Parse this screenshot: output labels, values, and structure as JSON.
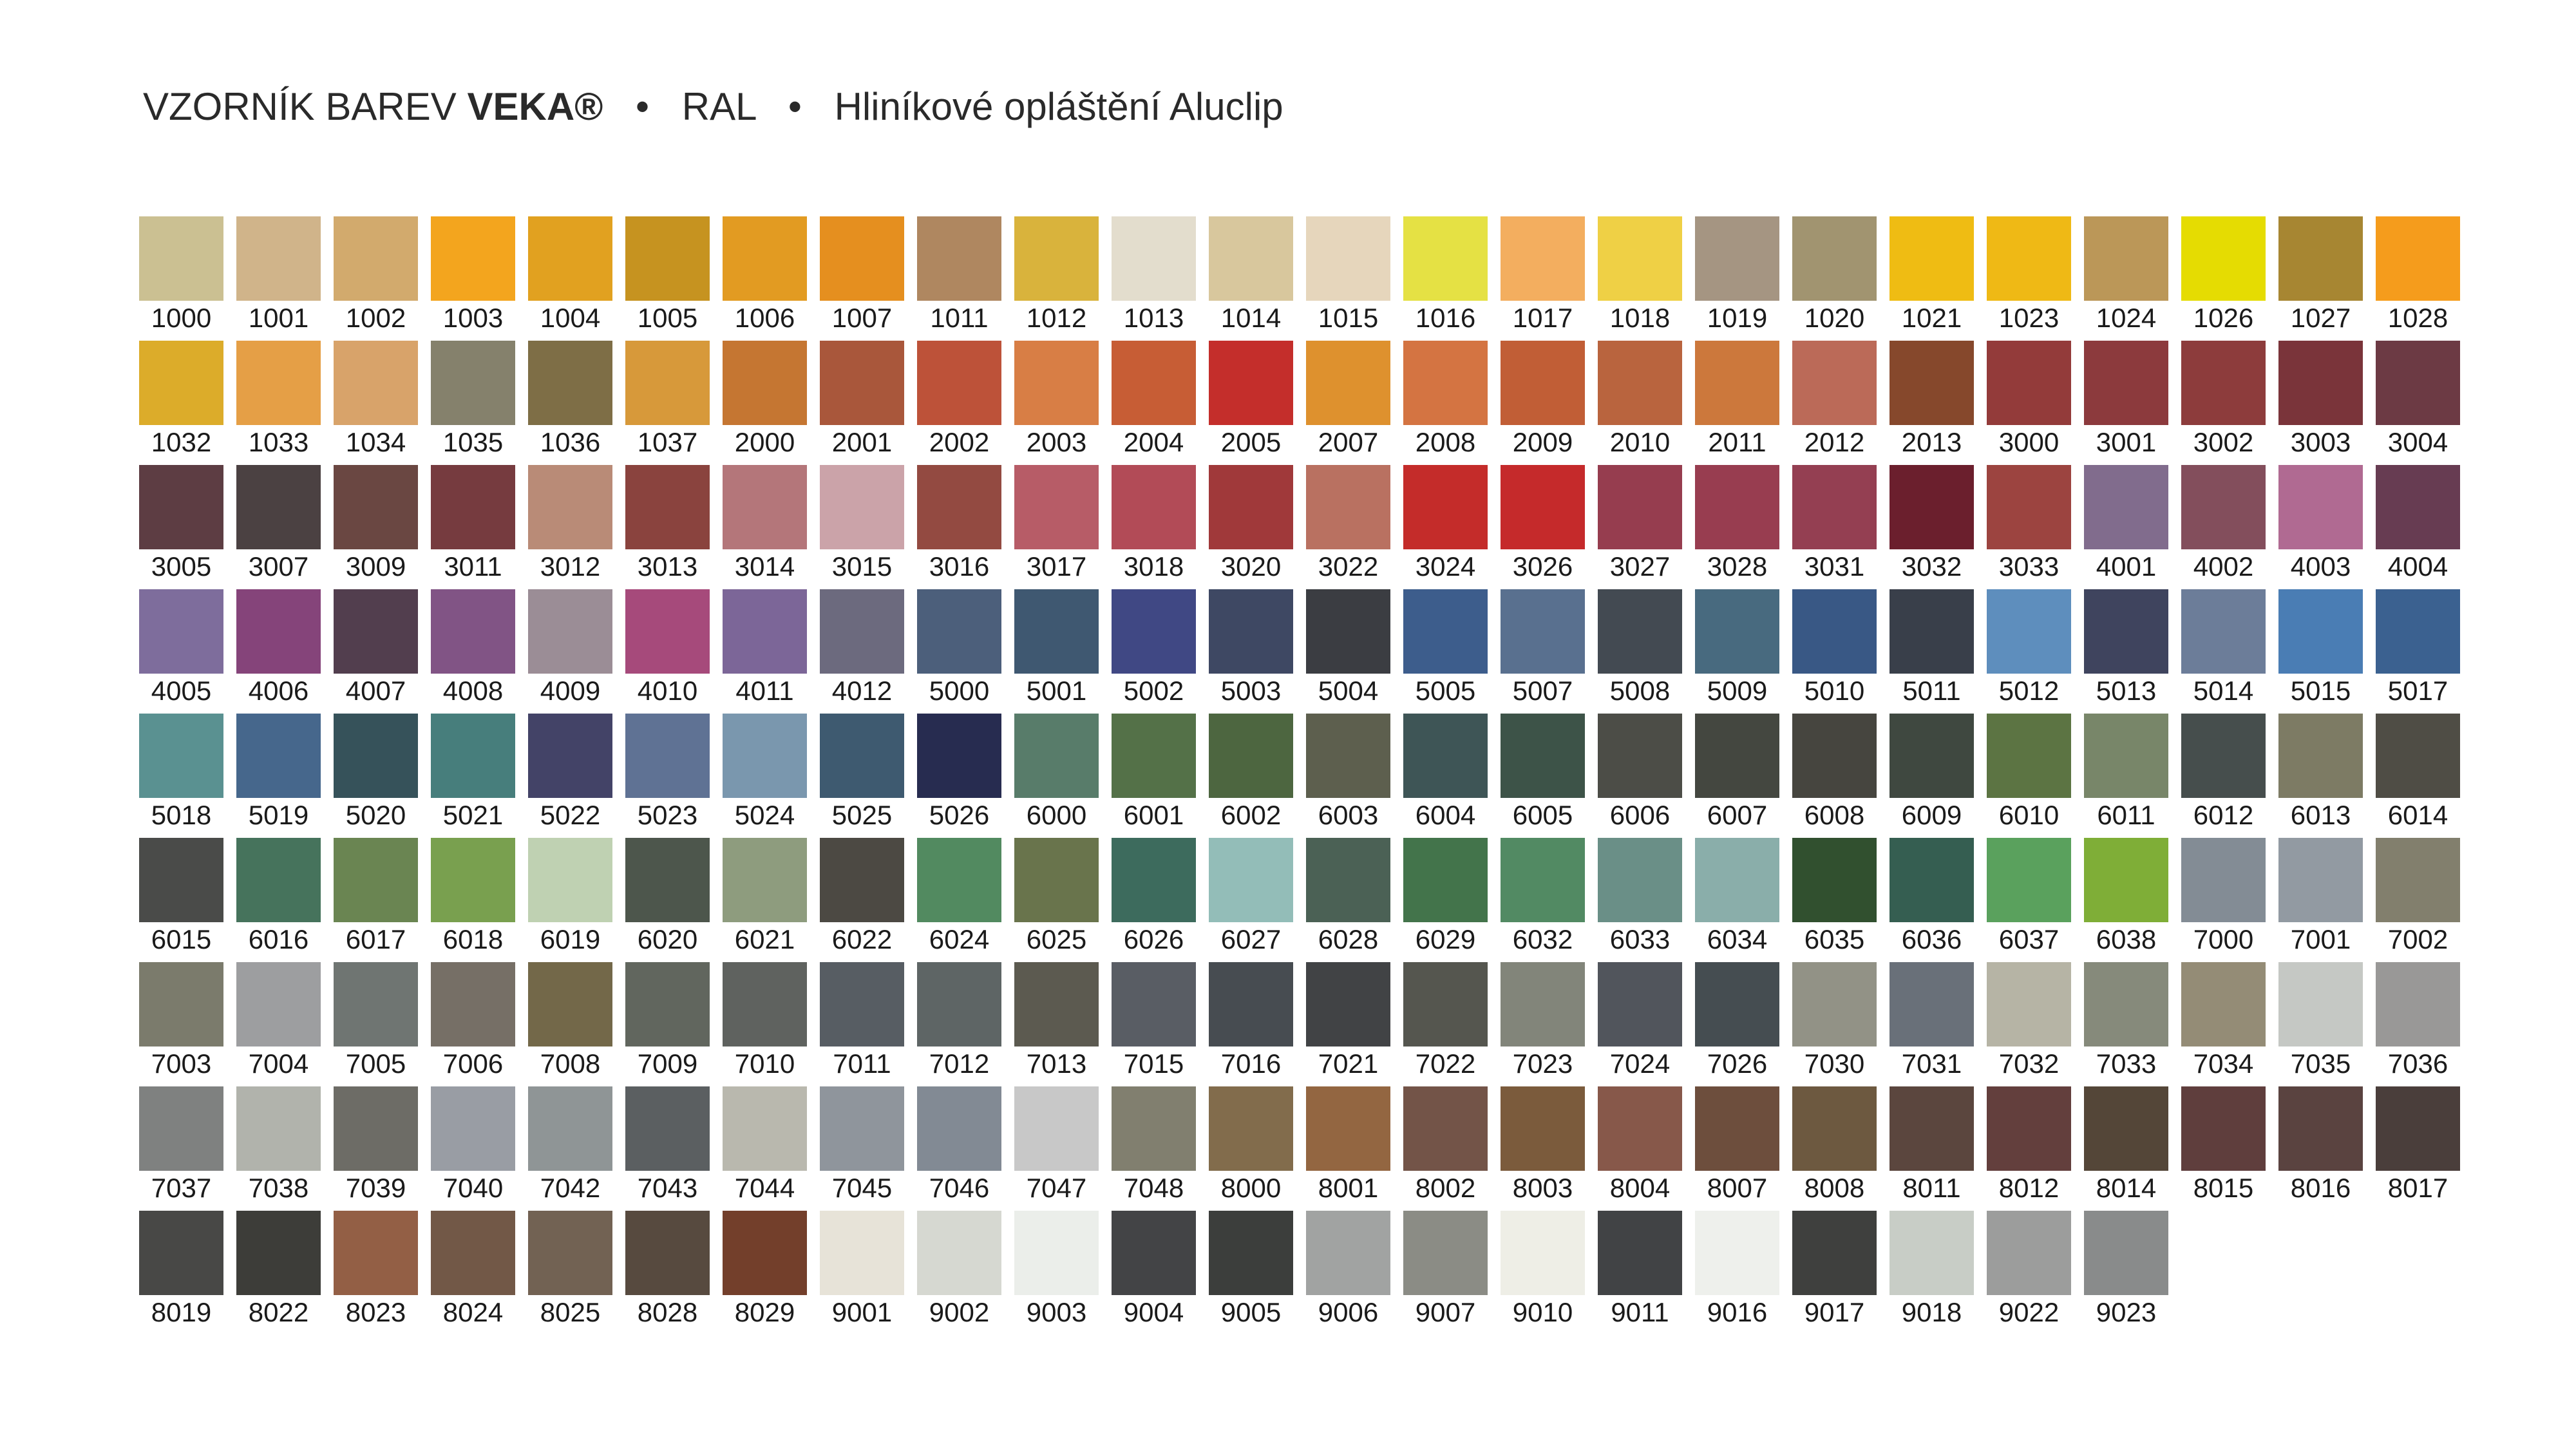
{
  "header": {
    "prefix": "VZORNÍK BAREV",
    "brand": "VEKA®",
    "separator": "•",
    "system": "RAL",
    "product": "Hliníkové opláštění Aluclip"
  },
  "colors": [
    {
      "code": "1000",
      "hex": "#cbc092"
    },
    {
      "code": "1001",
      "hex": "#d0b48a"
    },
    {
      "code": "1002",
      "hex": "#d2aa6d"
    },
    {
      "code": "1003",
      "hex": "#f3a51e"
    },
    {
      "code": "1004",
      "hex": "#e1a120"
    },
    {
      "code": "1005",
      "hex": "#c69320"
    },
    {
      "code": "1006",
      "hex": "#e29b22"
    },
    {
      "code": "1007",
      "hex": "#e58f1f"
    },
    {
      "code": "1011",
      "hex": "#af8760"
    },
    {
      "code": "1012",
      "hex": "#d9b33c"
    },
    {
      "code": "1013",
      "hex": "#e3ddcd"
    },
    {
      "code": "1014",
      "hex": "#d8c79d"
    },
    {
      "code": "1015",
      "hex": "#e6d6bc"
    },
    {
      "code": "1016",
      "hex": "#e5e144"
    },
    {
      "code": "1017",
      "hex": "#f3ae5f"
    },
    {
      "code": "1018",
      "hex": "#efd045"
    },
    {
      "code": "1019",
      "hex": "#a59582"
    },
    {
      "code": "1020",
      "hex": "#a19470"
    },
    {
      "code": "1021",
      "hex": "#efbc13"
    },
    {
      "code": "1023",
      "hex": "#efb915"
    },
    {
      "code": "1024",
      "hex": "#bb9758"
    },
    {
      "code": "1026",
      "hex": "#e5dc02"
    },
    {
      "code": "1027",
      "hex": "#a78632"
    },
    {
      "code": "1028",
      "hex": "#f59c1c"
    },
    {
      "code": "1032",
      "hex": "#dcac2a"
    },
    {
      "code": "1033",
      "hex": "#e59f46"
    },
    {
      "code": "1034",
      "hex": "#d8a36a"
    },
    {
      "code": "1035",
      "hex": "#85816c"
    },
    {
      "code": "1036",
      "hex": "#7e6e46"
    },
    {
      "code": "1037",
      "hex": "#d7993a"
    },
    {
      "code": "2000",
      "hex": "#c57632"
    },
    {
      "code": "2001",
      "hex": "#a9573b"
    },
    {
      "code": "2002",
      "hex": "#bd5239"
    },
    {
      "code": "2003",
      "hex": "#d87e45"
    },
    {
      "code": "2004",
      "hex": "#c75d35"
    },
    {
      "code": "2005",
      "hex": "#c42e2b"
    },
    {
      "code": "2007",
      "hex": "#de912e"
    },
    {
      "code": "2008",
      "hex": "#d47442"
    },
    {
      "code": "2009",
      "hex": "#c15e36"
    },
    {
      "code": "2010",
      "hex": "#b9643e"
    },
    {
      "code": "2011",
      "hex": "#cc783c"
    },
    {
      "code": "2012",
      "hex": "#bb6a58"
    },
    {
      "code": "2013",
      "hex": "#86482c"
    },
    {
      "code": "3000",
      "hex": "#933b3a"
    },
    {
      "code": "3001",
      "hex": "#8c3a3d"
    },
    {
      "code": "3002",
      "hex": "#8d3c3c"
    },
    {
      "code": "3003",
      "hex": "#7a343a"
    },
    {
      "code": "3004",
      "hex": "#6c3a44"
    },
    {
      "code": "3005",
      "hex": "#5d3d43"
    },
    {
      "code": "3007",
      "hex": "#4b4142"
    },
    {
      "code": "3009",
      "hex": "#6a4742"
    },
    {
      "code": "3011",
      "hex": "#763b3f"
    },
    {
      "code": "3012",
      "hex": "#b98b77"
    },
    {
      "code": "3013",
      "hex": "#8a433e"
    },
    {
      "code": "3014",
      "hex": "#b4767a"
    },
    {
      "code": "3015",
      "hex": "#cba3a9"
    },
    {
      "code": "3016",
      "hex": "#934a41"
    },
    {
      "code": "3017",
      "hex": "#b75c67"
    },
    {
      "code": "3018",
      "hex": "#b24b57"
    },
    {
      "code": "3020",
      "hex": "#a0393a"
    },
    {
      "code": "3022",
      "hex": "#b97161"
    },
    {
      "code": "3024",
      "hex": "#c42c2a"
    },
    {
      "code": "3026",
      "hex": "#c52a2b"
    },
    {
      "code": "3027",
      "hex": "#963d4f"
    },
    {
      "code": "3028",
      "hex": "#983d50"
    },
    {
      "code": "3031",
      "hex": "#943f52"
    },
    {
      "code": "3032",
      "hex": "#6b1f2d"
    },
    {
      "code": "3033",
      "hex": "#9c4440"
    },
    {
      "code": "4001",
      "hex": "#816c8d"
    },
    {
      "code": "4002",
      "hex": "#834e5c"
    },
    {
      "code": "4003",
      "hex": "#b06a92"
    },
    {
      "code": "4004",
      "hex": "#673c52"
    },
    {
      "code": "4005",
      "hex": "#7e6d9c"
    },
    {
      "code": "4006",
      "hex": "#85447a"
    },
    {
      "code": "4007",
      "hex": "#523e4e"
    },
    {
      "code": "4008",
      "hex": "#815485"
    },
    {
      "code": "4009",
      "hex": "#9b8d96"
    },
    {
      "code": "4010",
      "hex": "#a64a7b"
    },
    {
      "code": "4011",
      "hex": "#7c6698"
    },
    {
      "code": "4012",
      "hex": "#6c6a7e"
    },
    {
      "code": "5000",
      "hex": "#4c5f7b"
    },
    {
      "code": "5001",
      "hex": "#3f5871"
    },
    {
      "code": "5002",
      "hex": "#404884"
    },
    {
      "code": "5003",
      "hex": "#3e4863"
    },
    {
      "code": "5004",
      "hex": "#3b3d42"
    },
    {
      "code": "5005",
      "hex": "#3d5d8c"
    },
    {
      "code": "5007",
      "hex": "#59708f"
    },
    {
      "code": "5008",
      "hex": "#434a52"
    },
    {
      "code": "5009",
      "hex": "#486a7f"
    },
    {
      "code": "5010",
      "hex": "#395885"
    },
    {
      "code": "5011",
      "hex": "#393f4a"
    },
    {
      "code": "5012",
      "hex": "#5e8ebd"
    },
    {
      "code": "5013",
      "hex": "#3f445e"
    },
    {
      "code": "5014",
      "hex": "#6c7d99"
    },
    {
      "code": "5015",
      "hex": "#4a7db4"
    },
    {
      "code": "5017",
      "hex": "#3b6190"
    },
    {
      "code": "5018",
      "hex": "#5a9191"
    },
    {
      "code": "5019",
      "hex": "#46678c"
    },
    {
      "code": "5020",
      "hex": "#36525a"
    },
    {
      "code": "5021",
      "hex": "#477e7c"
    },
    {
      "code": "5022",
      "hex": "#434367"
    },
    {
      "code": "5023",
      "hex": "#5f7294"
    },
    {
      "code": "5024",
      "hex": "#7a97ae"
    },
    {
      "code": "5025",
      "hex": "#3e5a70"
    },
    {
      "code": "5026",
      "hex": "#272c50"
    },
    {
      "code": "6000",
      "hex": "#587c6a"
    },
    {
      "code": "6001",
      "hex": "#547148"
    },
    {
      "code": "6002",
      "hex": "#4d6640"
    },
    {
      "code": "6003",
      "hex": "#5d5f4e"
    },
    {
      "code": "6004",
      "hex": "#3e5556"
    },
    {
      "code": "6005",
      "hex": "#3d5348"
    },
    {
      "code": "6006",
      "hex": "#4c4d47"
    },
    {
      "code": "6007",
      "hex": "#444740"
    },
    {
      "code": "6008",
      "hex": "#46453f"
    },
    {
      "code": "6009",
      "hex": "#3f4840"
    },
    {
      "code": "6010",
      "hex": "#5c7443"
    },
    {
      "code": "6011",
      "hex": "#788669"
    },
    {
      "code": "6012",
      "hex": "#464e4d"
    },
    {
      "code": "6013",
      "hex": "#7d7b64"
    },
    {
      "code": "6014",
      "hex": "#4f4d45"
    },
    {
      "code": "6015",
      "hex": "#4a4b49"
    },
    {
      "code": "6016",
      "hex": "#46735c"
    },
    {
      "code": "6017",
      "hex": "#6a8552"
    },
    {
      "code": "6018",
      "hex": "#79a04f"
    },
    {
      "code": "6019",
      "hex": "#bfd1b2"
    },
    {
      "code": "6020",
      "hex": "#4d564c"
    },
    {
      "code": "6021",
      "hex": "#8e9c7e"
    },
    {
      "code": "6022",
      "hex": "#4c4943"
    },
    {
      "code": "6024",
      "hex": "#528a60"
    },
    {
      "code": "6025",
      "hex": "#69744c"
    },
    {
      "code": "6026",
      "hex": "#3d6b5d"
    },
    {
      "code": "6027",
      "hex": "#93bdb8"
    },
    {
      "code": "6028",
      "hex": "#4b6155"
    },
    {
      "code": "6029",
      "hex": "#43744b"
    },
    {
      "code": "6032",
      "hex": "#528a63"
    },
    {
      "code": "6033",
      "hex": "#6a8f87"
    },
    {
      "code": "6034",
      "hex": "#8aaeaa"
    },
    {
      "code": "6035",
      "hex": "#31502f"
    },
    {
      "code": "6036",
      "hex": "#355e51"
    },
    {
      "code": "6037",
      "hex": "#5aa15d"
    },
    {
      "code": "6038",
      "hex": "#7fae37"
    },
    {
      "code": "7000",
      "hex": "#838c95"
    },
    {
      "code": "7001",
      "hex": "#929aa2"
    },
    {
      "code": "7002",
      "hex": "#827f6d"
    },
    {
      "code": "7003",
      "hex": "#7b7b6c"
    },
    {
      "code": "7004",
      "hex": "#9d9ea0"
    },
    {
      "code": "7005",
      "hex": "#6f7572"
    },
    {
      "code": "7006",
      "hex": "#766f66"
    },
    {
      "code": "7008",
      "hex": "#736849"
    },
    {
      "code": "7009",
      "hex": "#61665e"
    },
    {
      "code": "7010",
      "hex": "#5f625f"
    },
    {
      "code": "7011",
      "hex": "#575d63"
    },
    {
      "code": "7012",
      "hex": "#5e6565"
    },
    {
      "code": "7013",
      "hex": "#5c5a50"
    },
    {
      "code": "7015",
      "hex": "#595d64"
    },
    {
      "code": "7016",
      "hex": "#474c51"
    },
    {
      "code": "7021",
      "hex": "#414345"
    },
    {
      "code": "7022",
      "hex": "#55564f"
    },
    {
      "code": "7023",
      "hex": "#82857a"
    },
    {
      "code": "7024",
      "hex": "#51555c"
    },
    {
      "code": "7026",
      "hex": "#454d51"
    },
    {
      "code": "7030",
      "hex": "#929286"
    },
    {
      "code": "7031",
      "hex": "#697079"
    },
    {
      "code": "7032",
      "hex": "#b6b4a5"
    },
    {
      "code": "7033",
      "hex": "#868a7b"
    },
    {
      "code": "7034",
      "hex": "#948c76"
    },
    {
      "code": "7035",
      "hex": "#c5c8c4"
    },
    {
      "code": "7036",
      "hex": "#999897"
    },
    {
      "code": "7037",
      "hex": "#7f8180"
    },
    {
      "code": "7038",
      "hex": "#b1b3ac"
    },
    {
      "code": "7039",
      "hex": "#6d6c66"
    },
    {
      "code": "7040",
      "hex": "#999da4"
    },
    {
      "code": "7042",
      "hex": "#8f9596"
    },
    {
      "code": "7043",
      "hex": "#5b5f61"
    },
    {
      "code": "7044",
      "hex": "#b9b8ae"
    },
    {
      "code": "7045",
      "hex": "#8f959c"
    },
    {
      "code": "7046",
      "hex": "#828a94"
    },
    {
      "code": "7047",
      "hex": "#c8c8c8"
    },
    {
      "code": "7048",
      "hex": "#817f6f"
    },
    {
      "code": "8000",
      "hex": "#826c4c"
    },
    {
      "code": "8001",
      "hex": "#936641"
    },
    {
      "code": "8002",
      "hex": "#735448"
    },
    {
      "code": "8003",
      "hex": "#7b5b3c"
    },
    {
      "code": "8004",
      "hex": "#87584a"
    },
    {
      "code": "8007",
      "hex": "#6d4e3d"
    },
    {
      "code": "8008",
      "hex": "#6d5940"
    },
    {
      "code": "8011",
      "hex": "#5b463e"
    },
    {
      "code": "8012",
      "hex": "#633f3d"
    },
    {
      "code": "8014",
      "hex": "#544638"
    },
    {
      "code": "8015",
      "hex": "#5f3e3d"
    },
    {
      "code": "8016",
      "hex": "#5a4340"
    },
    {
      "code": "8017",
      "hex": "#4a3e3b"
    },
    {
      "code": "8019",
      "hex": "#484846"
    },
    {
      "code": "8022",
      "hex": "#3d3d39"
    },
    {
      "code": "8023",
      "hex": "#935f45"
    },
    {
      "code": "8024",
      "hex": "#725847"
    },
    {
      "code": "8025",
      "hex": "#726253"
    },
    {
      "code": "8028",
      "hex": "#574a3f"
    },
    {
      "code": "8029",
      "hex": "#733f2b"
    },
    {
      "code": "9001",
      "hex": "#e7e3d8"
    },
    {
      "code": "9002",
      "hex": "#d6d8d1"
    },
    {
      "code": "9003",
      "hex": "#ebeeea"
    },
    {
      "code": "9004",
      "hex": "#434446"
    },
    {
      "code": "9005",
      "hex": "#3c3e3c"
    },
    {
      "code": "9006",
      "hex": "#a1a3a2"
    },
    {
      "code": "9007",
      "hex": "#8b8c85"
    },
    {
      "code": "9010",
      "hex": "#eeeee6"
    },
    {
      "code": "9011",
      "hex": "#414345"
    },
    {
      "code": "9016",
      "hex": "#eef0ec"
    },
    {
      "code": "9017",
      "hex": "#3f403e"
    },
    {
      "code": "9018",
      "hex": "#c8cdc6"
    },
    {
      "code": "9022",
      "hex": "#9c9d9c"
    },
    {
      "code": "9023",
      "hex": "#898b8b"
    }
  ]
}
